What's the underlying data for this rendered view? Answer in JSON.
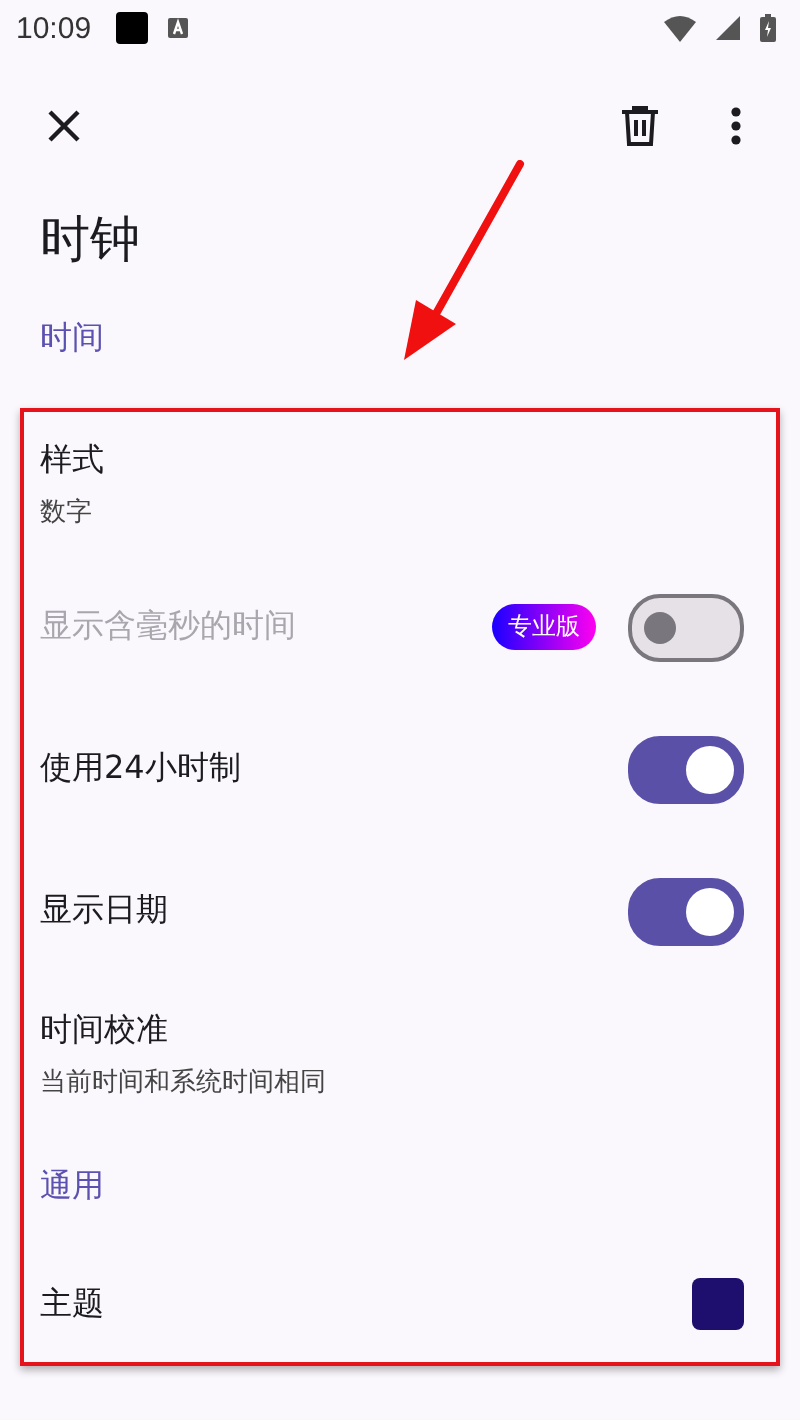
{
  "status_bar": {
    "time": "10:09"
  },
  "toolbar": {
    "title": "时钟"
  },
  "section_title": "时间",
  "highlight_frame": {
    "entries": [
      {
        "kind": "text",
        "title": "样式",
        "subtitle": "数字"
      },
      {
        "kind": "switch",
        "title": "显示含毫秒的时间",
        "badge": "专业版",
        "on": false,
        "disabled": true
      },
      {
        "kind": "switch",
        "title": "使用24小时制",
        "on": true,
        "disabled": false
      },
      {
        "kind": "switch",
        "title": "显示日期",
        "on": true,
        "disabled": false
      },
      {
        "kind": "text",
        "title": "时间校准",
        "subtitle": "当前时间和系统时间相同"
      },
      {
        "kind": "header",
        "title": "通用"
      },
      {
        "kind": "color",
        "title": "主题",
        "color": "#1e0f6e"
      }
    ]
  }
}
